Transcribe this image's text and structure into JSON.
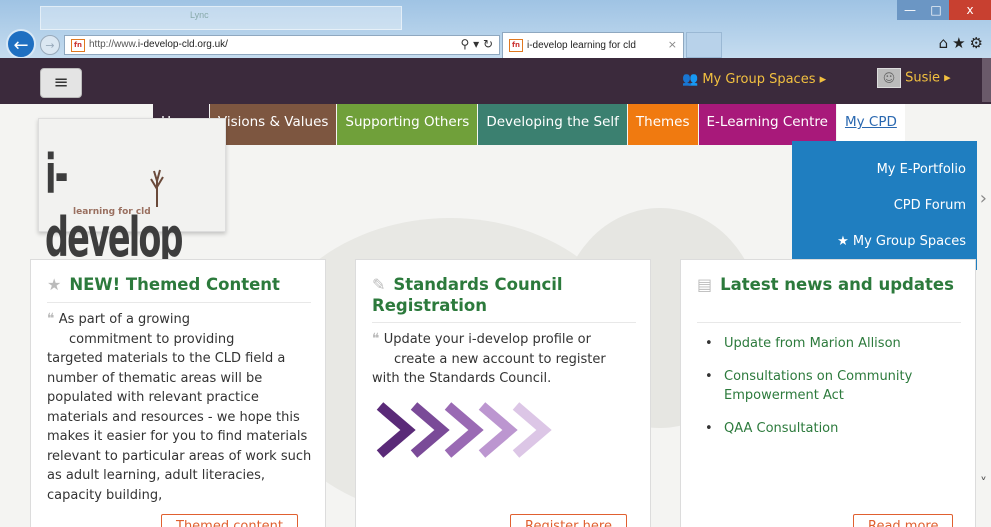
{
  "browser": {
    "back_icon": "back-arrow-icon",
    "ghost_window_title": "Lync",
    "url_prefix": "http://www.",
    "url_domain": "i-develop-cld.org.uk/",
    "address_icons": "⚲ ▾ ↻",
    "tab_title": "i-develop learning for cld",
    "tab_close": "×",
    "favicon_text": "fn",
    "window_buttons": [
      "—",
      "□",
      "x"
    ],
    "toolbar_icons": "⌂★⚙"
  },
  "site": {
    "menu_icon": "≡",
    "group_spaces_label": "My Group Spaces ▸",
    "group_spaces_icon": "👥",
    "user_label": "Susie ▸",
    "logo_text": "i-develop",
    "logo_sub": "learning for cld"
  },
  "nav": {
    "items": [
      {
        "label": "Home",
        "color": "#3b2a3c"
      },
      {
        "label": "Visions & Values",
        "color": "#7d5640"
      },
      {
        "label": "Supporting Others",
        "color": "#70a03a"
      },
      {
        "label": "Developing the Self",
        "color": "#3b8070"
      },
      {
        "label": "Themes",
        "color": "#f07a10"
      },
      {
        "label": "E-Learning Centre",
        "color": "#a8197a"
      },
      {
        "label": "My CPD",
        "color": "#ffffff"
      }
    ]
  },
  "dropdown": {
    "items": [
      "My E-Portfolio",
      "CPD Forum",
      "★ My Group Spaces"
    ]
  },
  "cards": [
    {
      "icon": "★",
      "title": "NEW! Themed Content",
      "quote": "❝",
      "text_lead": "As part of a growing",
      "text_indent": "commitment to providing",
      "text_rest": "targeted materials to the CLD field a number of thematic areas will be populated with relevant practice materials and resources - we hope this makes it easier for you to find materials relevant to particular areas of work such as adult learning, adult literacies, capacity building,",
      "button": "Themed content"
    },
    {
      "icon": "✎",
      "title": "Standards Council Registration",
      "quote": "❝",
      "text_lead": "Update your i-develop profile or",
      "text_indent": "create a new account to register",
      "text_rest": "with the Standards Council.",
      "button": "Register here"
    },
    {
      "icon": "▤",
      "title": "Latest news and updates",
      "news": [
        "Update from Marion Allison",
        "Consultations on Community Empowerment Act",
        "QAA Consultation"
      ],
      "button": "Read more"
    }
  ]
}
